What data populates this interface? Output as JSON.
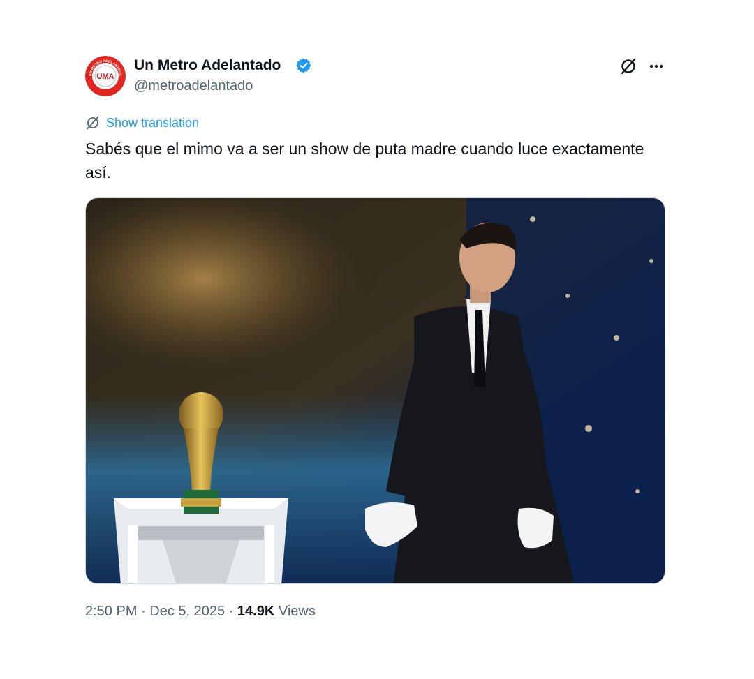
{
  "author": {
    "name": "Un Metro Adelantado",
    "handle": "@metroadelantado",
    "verified": true,
    "avatar_icon": "uma-logo-avatar",
    "avatar_text": "UMA",
    "avatar_ring_text": "UN METRO ADELANTADO",
    "brand_color": "#e0261f"
  },
  "header_actions": {
    "grok_icon": "grok-slash-icon",
    "more_icon": "more-dots-icon"
  },
  "translation": {
    "label": "Show translation",
    "icon": "translate-slash-icon",
    "color": "#1d9bf0"
  },
  "tweet": {
    "text": "Sabés que el mimo va a ser un show de puta madre cuando luce exactamente así."
  },
  "media": {
    "type": "photo",
    "subject_icons": [
      "world-cup-trophy",
      "man-in-suit-white-gloves",
      "stage-pedestal"
    ]
  },
  "meta": {
    "time": "2:50 PM",
    "separator": " · ",
    "date": "Dec 5, 2025",
    "views_count": "14.9K",
    "views_label": " Views"
  },
  "colors": {
    "text_primary": "#0f1419",
    "text_secondary": "#536471",
    "verified": "#1d9bf0"
  }
}
